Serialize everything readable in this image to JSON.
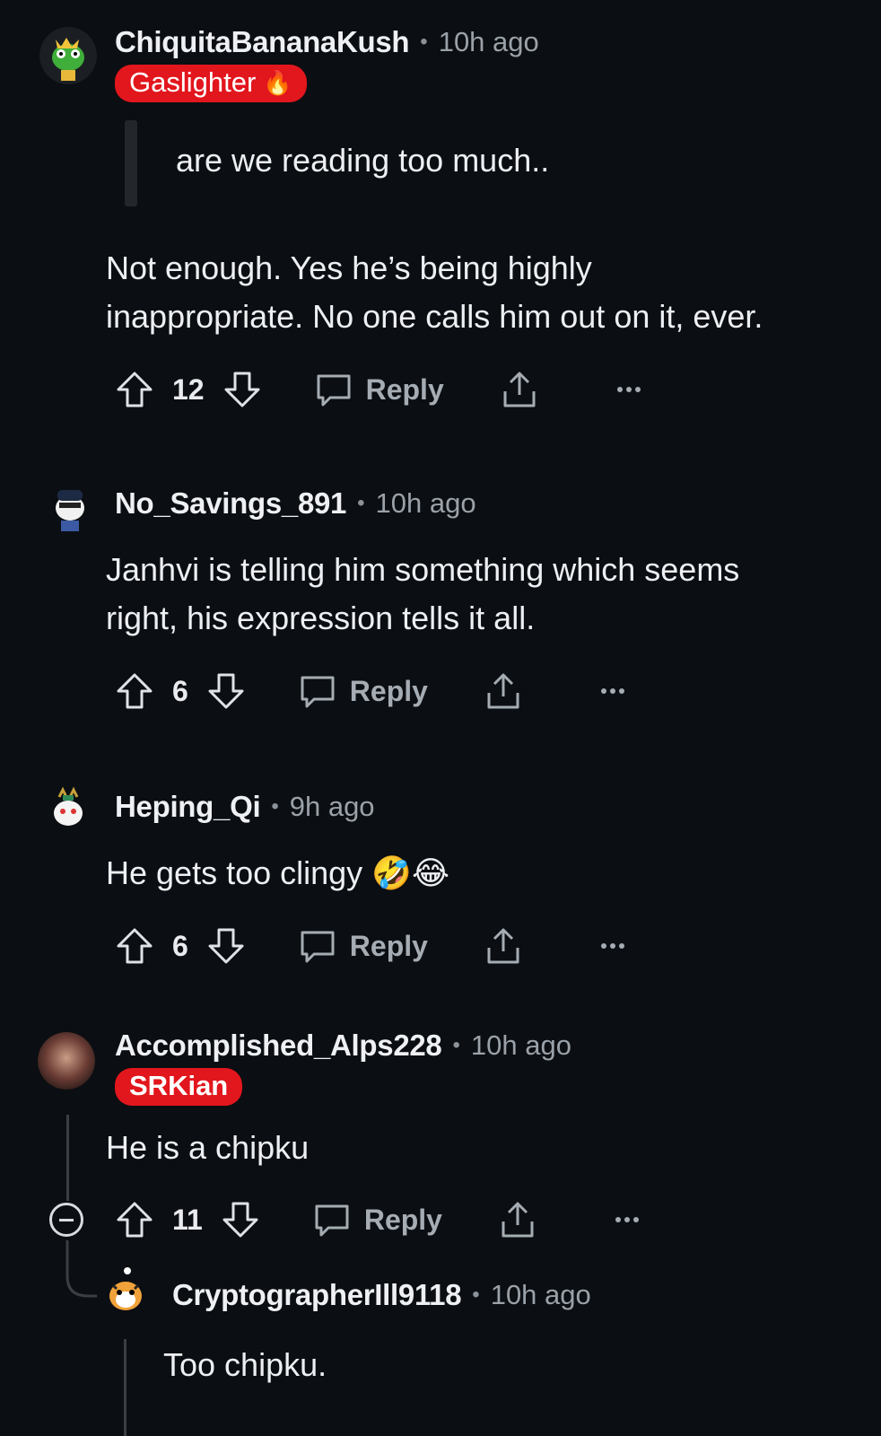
{
  "comments": [
    {
      "username": "ChiquitaBananaKush",
      "time": "10h ago",
      "flair": "Gaslighter",
      "flair_emoji": "🔥",
      "quote": "are we reading too much..",
      "body_line1": "Not enough. Yes he’s being highly",
      "body_line2": "inappropriate. No one calls him out on it, ever.",
      "votes": "12",
      "reply_label": "Reply"
    },
    {
      "username": "No_Savings_891",
      "time": "10h ago",
      "body_line1": "Janhvi is telling him something which seems",
      "body_line2": "right, his expression tells it all.",
      "votes": "6",
      "reply_label": "Reply"
    },
    {
      "username": "Heping_Qi",
      "time": "9h ago",
      "body_line1": "He gets too clingy 🤣😂",
      "votes": "6",
      "reply_label": "Reply"
    },
    {
      "username": "Accomplished_Alps228",
      "time": "10h ago",
      "flair": "SRKian",
      "body_line1": "He is a chipku",
      "votes": "11",
      "reply_label": "Reply"
    },
    {
      "username": "CryptographerIll9118",
      "time": "10h ago",
      "body_line1": "Too chipku."
    }
  ],
  "separator": "•",
  "colors": {
    "background": "#0b0e12",
    "flair_red": "#e2161d",
    "muted_text": "#9aa1a8"
  }
}
